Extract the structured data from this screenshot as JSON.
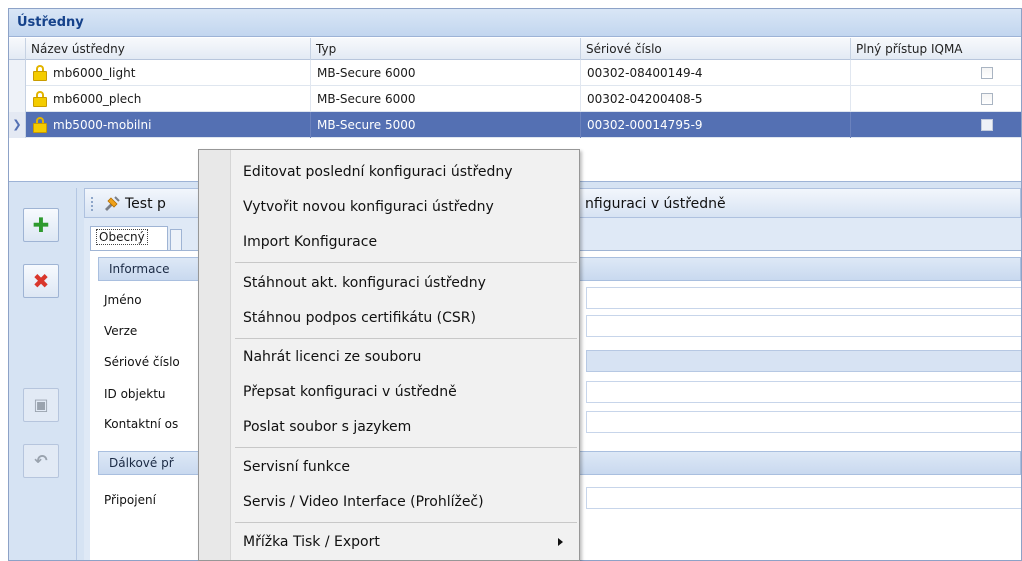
{
  "panel": {
    "title": "Ústředny"
  },
  "grid": {
    "columns": [
      "Název ústředny",
      "Typ",
      "Sériové číslo",
      "Plný přístup IQMA"
    ],
    "rows": [
      {
        "name": "mb6000_light",
        "type": "MB-Secure 6000",
        "serial": "00302-08400149-4",
        "full_access": false,
        "selected": false
      },
      {
        "name": "mb6000_plech",
        "type": "MB-Secure 6000",
        "serial": "00302-04200408-5",
        "full_access": false,
        "selected": false
      },
      {
        "name": "mb5000-mobilni",
        "type": "MB-Secure 5000",
        "serial": "00302-00014795-9",
        "full_access": false,
        "selected": true
      }
    ]
  },
  "toolbar": {
    "test_label_partial": "Test p",
    "right_label_partial": "nfiguraci v ústředně"
  },
  "tabs": {
    "general": "Obecný"
  },
  "form": {
    "group_info": "Informace",
    "fields": [
      "Jméno",
      "Verze",
      "Sériové číslo",
      "ID objektu",
      "Kontaktní os"
    ],
    "group_remote": "Dálkové př",
    "remote_fields": [
      "Připojení"
    ]
  },
  "context_menu": {
    "items": [
      "Editovat poslední konfiguraci ústředny",
      "Vytvořit novou konfiguraci ústředny",
      "Import Konfigurace",
      "Stáhnout akt. konfiguraci ústředny",
      "Stáhnou podpos certifikátu (CSR)",
      "Nahrát licenci ze souboru",
      "Přepsat konfiguraci v ústředně",
      "Poslat soubor s jazykem",
      "Servisní funkce",
      "Servis / Video Interface (Prohlížeč)",
      "Mřížka Tisk / Export"
    ]
  },
  "colors": {
    "selection": "#5470b3",
    "title_text": "#15428b",
    "add_icon": "#2e9a2e",
    "delete_icon": "#d9362b"
  },
  "icons": [
    "lock-icon",
    "add-icon",
    "delete-icon",
    "save-icon",
    "undo-icon",
    "test-connection-icon",
    "submenu-arrow-icon",
    "row-indicator-icon"
  ]
}
